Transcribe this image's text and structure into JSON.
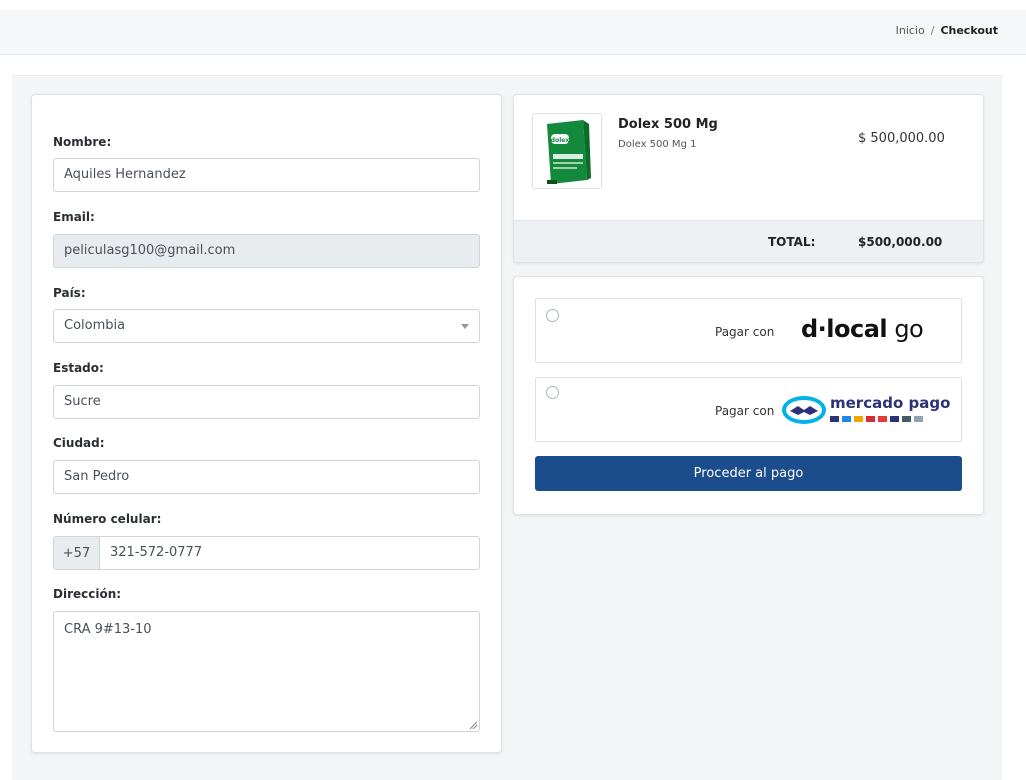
{
  "breadcrumb": {
    "home": "Inicio",
    "separator": "/",
    "current": "Checkout"
  },
  "form": {
    "nombre": {
      "label": "Nombre:",
      "value": "Aquiles Hernandez"
    },
    "email": {
      "label": "Email:",
      "value": "peliculasg100@gmail.com"
    },
    "pais": {
      "label": "País:",
      "value": "Colombia"
    },
    "estado": {
      "label": "Estado:",
      "value": "Sucre"
    },
    "ciudad": {
      "label": "Ciudad:",
      "value": "San Pedro"
    },
    "celular": {
      "label": "Número celular:",
      "prefix": "+57",
      "value": "321-572-0777"
    },
    "direccion": {
      "label": "Dirección:",
      "value": "CRA 9#13-10"
    }
  },
  "order": {
    "product": {
      "name": "Dolex 500 Mg",
      "subtitle": "Dolex 500 Mg 1",
      "price": "$ 500,000.00",
      "image_icon": "dolex-box-icon",
      "image_text": "dolex"
    },
    "total_label": "TOTAL:",
    "total_value": "$500,000.00"
  },
  "payment": {
    "options": [
      {
        "label": "Pagar con",
        "provider": "dlocal go",
        "logo_text_main": "d·local",
        "logo_text_suffix": "go"
      },
      {
        "label": "Pagar con",
        "provider": "mercado pago",
        "logo_text": "mercado pago"
      }
    ],
    "proceed_label": "Proceder al pago"
  },
  "colors": {
    "primary_button": "#1b4d8c",
    "mercado_blue": "#2d3277",
    "mercado_light": "#00b1ea",
    "dolex_green": "#138a3b"
  }
}
